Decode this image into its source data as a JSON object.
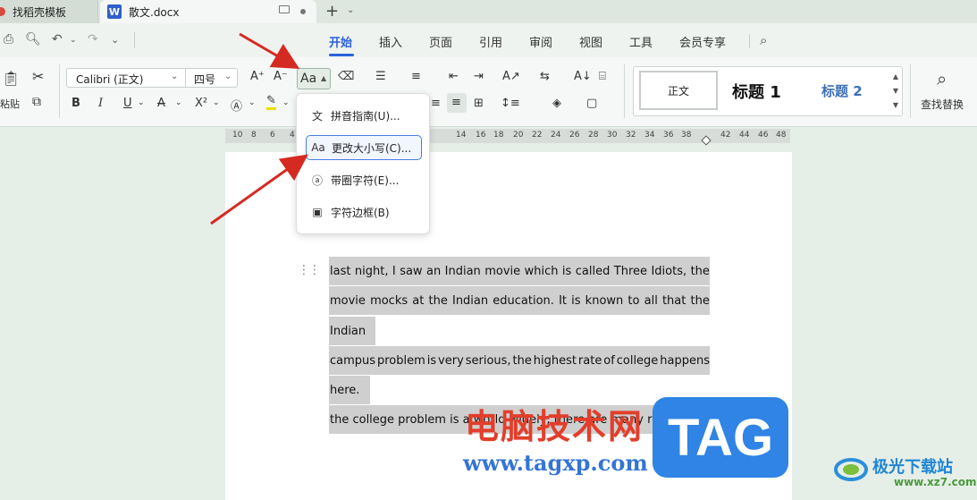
{
  "titlebar": {
    "tabs": [
      {
        "label": "找稻壳模板"
      },
      {
        "label": "散文.docx",
        "icon": "W"
      }
    ]
  },
  "menu": {
    "items": [
      "开始",
      "插入",
      "页面",
      "引用",
      "审阅",
      "视图",
      "工具",
      "会员专享"
    ],
    "active": "开始"
  },
  "ribbon": {
    "paste_label": "粘贴",
    "font_name": "Calibri (正文)",
    "font_size": "四号",
    "bold": "B",
    "italic": "I",
    "underline": "U",
    "aa_label": "Aa",
    "styles": {
      "normal": "正文",
      "h1": "标题  1",
      "h2": "标题  2"
    },
    "find_replace": "查找替换"
  },
  "ruler": {
    "ticks": [
      "10",
      "8",
      "6",
      "4",
      "12",
      "14",
      "16",
      "18",
      "20",
      "22",
      "24",
      "26",
      "28",
      "30",
      "32",
      "34",
      "36",
      "38",
      "42",
      "44",
      "46",
      "48"
    ]
  },
  "dropdown": {
    "items": [
      {
        "label": "拼音指南(U)...",
        "icon": "pinyin-guide-icon"
      },
      {
        "label": "更改大小写(C)...",
        "icon": "change-case-icon",
        "highlighted": true
      },
      {
        "label": "带圈字符(E)...",
        "icon": "enclosed-char-icon"
      },
      {
        "label": "字符边框(B)",
        "icon": "char-border-icon"
      }
    ]
  },
  "document": {
    "lines": [
      "last night, I saw an Indian movie which is called Three Idiots, the",
      "movie mocks at the Indian education. It is known to all that the",
      "Indian",
      "campus problem is very serious, the highest rate of college happens",
      "here.",
      "the college problem is a world widely, there are many reasons"
    ]
  },
  "watermark": {
    "cn_text": "电脑技术网",
    "url": "www.tagxp.com",
    "tag": "TAG",
    "site_name": "极光下载站",
    "site_url": "www.xz7.com"
  },
  "colors": {
    "accent": "#2b62d9",
    "arrow": "#d42a22",
    "selection": "#cfcfcf"
  }
}
